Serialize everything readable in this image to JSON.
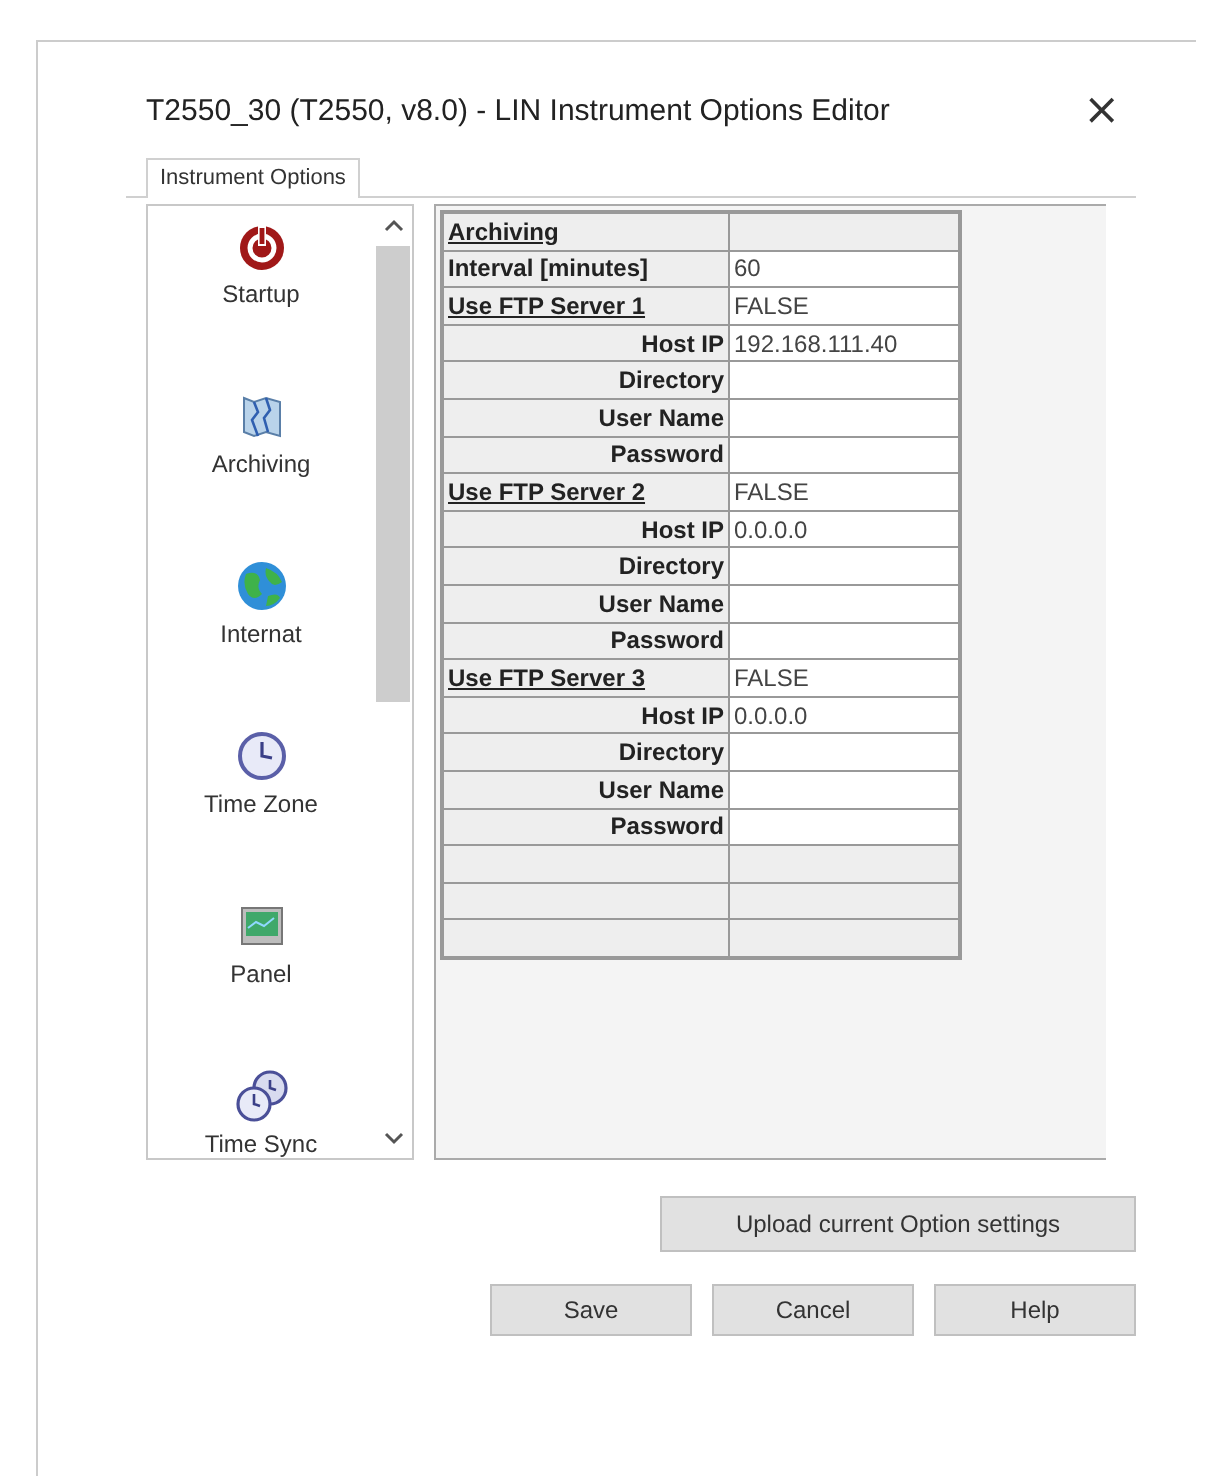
{
  "window": {
    "title": "T2550_30 (T2550, v8.0) - LIN Instrument Options Editor",
    "close": "×"
  },
  "tabs": [
    {
      "label": "Instrument Options",
      "selected": true
    }
  ],
  "sidebar": {
    "items": [
      {
        "label": "Startup",
        "kind": "power"
      },
      {
        "label": "Archiving",
        "kind": "map"
      },
      {
        "label": "Internat",
        "kind": "globe"
      },
      {
        "label": "Time Zone",
        "kind": "clock"
      },
      {
        "label": "Panel",
        "kind": "panel"
      },
      {
        "label": "Time Sync",
        "kind": "clocks"
      }
    ]
  },
  "table": {
    "rows": [
      {
        "kind": "section",
        "label": "Archiving"
      },
      {
        "kind": "field",
        "label": "Interval [minutes]",
        "value": "60"
      },
      {
        "kind": "toggle",
        "label": "Use FTP Server 1",
        "value": "FALSE"
      },
      {
        "kind": "sub",
        "label": "Host IP",
        "value": "192.168.111.40"
      },
      {
        "kind": "sub",
        "label": "Directory"
      },
      {
        "kind": "sub",
        "label": "User Name"
      },
      {
        "kind": "sub",
        "label": "Password"
      },
      {
        "kind": "toggle",
        "label": "Use FTP Server 2",
        "value": "FALSE"
      },
      {
        "kind": "sub",
        "label": "Host IP",
        "value": "0.0.0.0"
      },
      {
        "kind": "sub",
        "label": "Directory"
      },
      {
        "kind": "sub",
        "label": "User Name"
      },
      {
        "kind": "sub",
        "label": "Password"
      },
      {
        "kind": "toggle",
        "label": "Use FTP Server 3",
        "value": "FALSE"
      },
      {
        "kind": "sub",
        "label": "Host IP",
        "value": "0.0.0.0"
      },
      {
        "kind": "sub",
        "label": "Directory"
      },
      {
        "kind": "sub",
        "label": "User Name"
      },
      {
        "kind": "sub",
        "label": "Password"
      },
      {
        "kind": "empty"
      },
      {
        "kind": "empty"
      },
      {
        "kind": "empty"
      }
    ]
  },
  "upload_button": "Upload current Option settings",
  "buttons": [
    "Save",
    "Cancel",
    "Help"
  ]
}
